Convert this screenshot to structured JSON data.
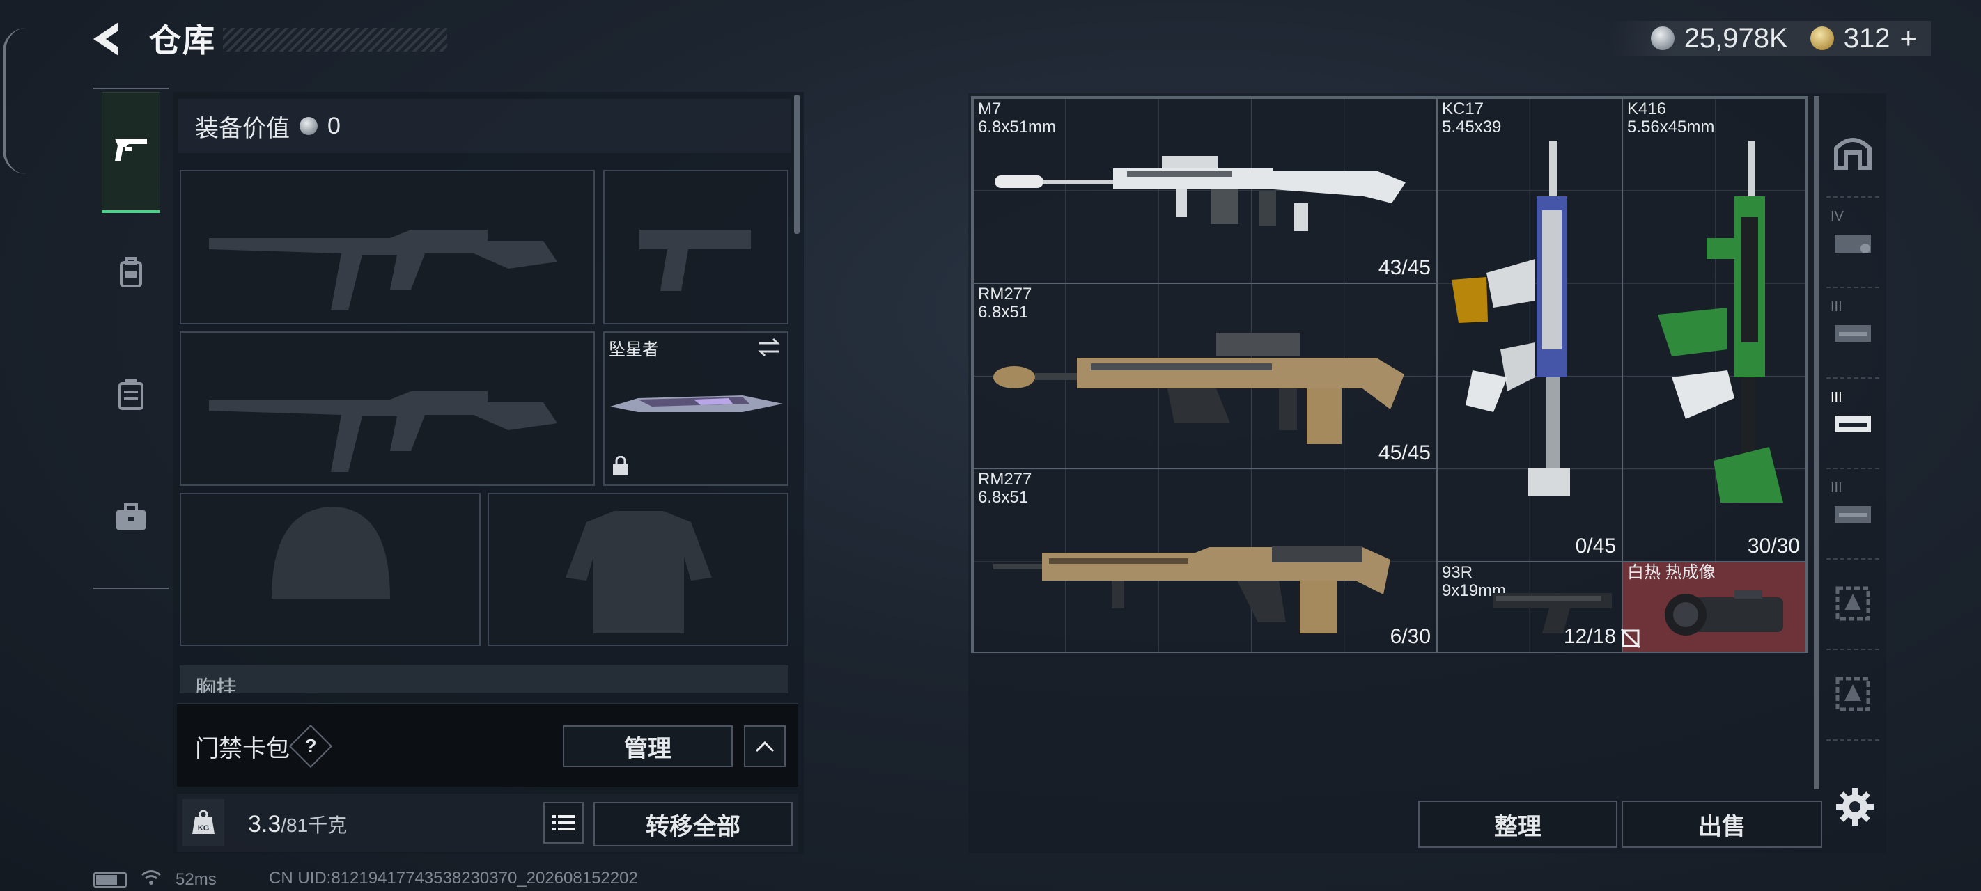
{
  "header": {
    "title": "仓库"
  },
  "currency": {
    "silver": "25,978K",
    "gold": "312",
    "add": "+"
  },
  "loadout": {
    "value_label": "装备价值",
    "value": "0",
    "melee_name": "坠星者",
    "chest_label": "胸挂",
    "access_label": "门禁卡包",
    "help": "?",
    "manage": "管理"
  },
  "capacity": {
    "current": "3.3",
    "max": "/81千克",
    "transfer_all": "转移全部",
    "kg": "KG"
  },
  "status": {
    "ping": "52ms",
    "uid": "CN UID:8121941774353823037​0_202608152202"
  },
  "weapons": [
    {
      "name": "M7",
      "caliber": "6.8x51mm",
      "ammo": "43/45"
    },
    {
      "name": "RM277",
      "caliber": "6.8x51",
      "ammo": "45/45"
    },
    {
      "name": "RM277",
      "caliber": "6.8x51",
      "ammo": "6/30"
    },
    {
      "name": "KC17",
      "caliber": "5.45x39",
      "ammo": "0/45"
    },
    {
      "name": "K416",
      "caliber": "5.56x45mm",
      "ammo": "30/30"
    },
    {
      "name": "93R",
      "caliber": "9x19mm",
      "ammo": "12/18"
    },
    {
      "name": "白热 热成像",
      "caliber": "",
      "ammo": ""
    }
  ],
  "right_nav": {
    "tier_labels": [
      "IV",
      "III",
      "III",
      "III"
    ]
  },
  "actions": {
    "sort": "整理",
    "sell": "出售"
  },
  "colors": {
    "accent_green": "#4fd08a",
    "thermal_bg": "#6e3338",
    "panel": "#161c24"
  }
}
